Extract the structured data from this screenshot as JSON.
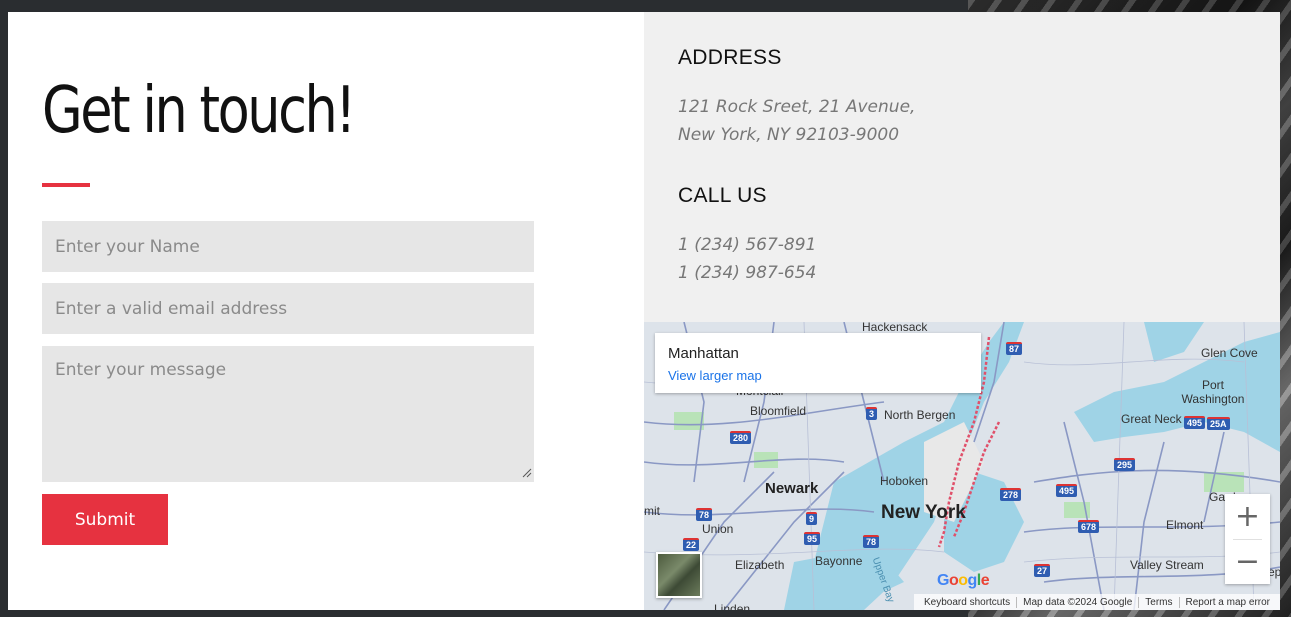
{
  "form": {
    "title": "Get in touch!",
    "name_placeholder": "Enter your Name",
    "email_placeholder": "Enter a valid email address",
    "message_placeholder": "Enter your message",
    "submit_label": "Submit",
    "accent_color": "#e63240"
  },
  "contact": {
    "address_heading": "ADDRESS",
    "address_line1": "121 Rock Sreet, 21 Avenue,",
    "address_line2": "New York, NY 92103-9000",
    "call_heading": "CALL US",
    "phone1": "1 (234) 567-891",
    "phone2": "1 (234) 987-654"
  },
  "map": {
    "place_name": "Manhattan",
    "view_larger_label": "View larger map",
    "zoom_in_label": "+",
    "zoom_out_label": "−",
    "google_logo": [
      "G",
      "o",
      "o",
      "g",
      "l",
      "e"
    ],
    "attribution": {
      "shortcuts": "Keyboard shortcuts",
      "data": "Map data ©2024 Google",
      "terms": "Terms",
      "report": "Report a map error"
    },
    "labels": {
      "hackensack": "Hackensack",
      "montclair": "Montclair",
      "bloomfield": "Bloomfield",
      "north_bergen": "North Bergen",
      "glen_cove": "Glen Cove",
      "port_washington": "Port\nWashington",
      "great_neck": "Great Neck",
      "hoboken": "Hoboken",
      "newark": "Newark",
      "new_york": "New York",
      "union": "Union",
      "elizabeth": "Elizabeth",
      "bayonne": "Bayonne",
      "upper_bay": "Upper Bay",
      "elmont": "Elmont",
      "valley_stream": "Valley Stream",
      "garden": "Gard",
      "mit": "mit",
      "linden": "Linden",
      "ep": "ep"
    },
    "shields": [
      "87",
      "3",
      "280",
      "495",
      "25A",
      "295",
      "278",
      "495",
      "78",
      "9",
      "678",
      "22",
      "95",
      "78",
      "27"
    ]
  }
}
